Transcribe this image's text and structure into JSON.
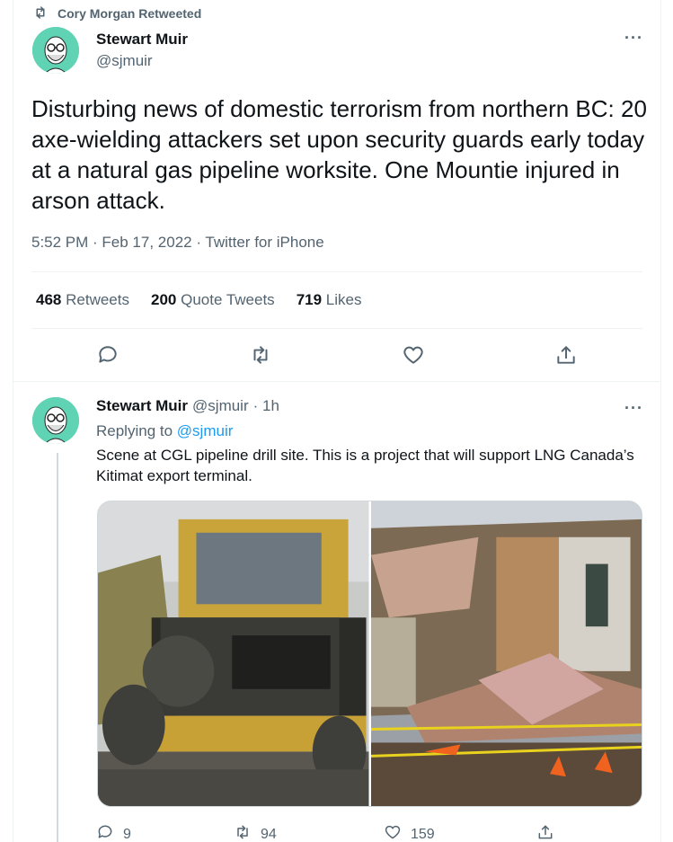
{
  "retweet_banner": {
    "text": "Cory Morgan Retweeted",
    "icon": "retweet-icon"
  },
  "main_tweet": {
    "author": {
      "name": "Stewart Muir",
      "handle": "@sjmuir"
    },
    "more_label": "···",
    "text": "Disturbing news of domestic terrorism from northern BC: 20 axe-wielding attackers set upon security guards early today at a natural gas pipeline worksite. One Mountie injured in arson attack.",
    "meta": "5:52 PM · Feb 17, 2022 · Twitter for iPhone",
    "stats": {
      "retweets_count": "468",
      "retweets_label": "Retweets",
      "quotes_count": "200",
      "quotes_label": "Quote Tweets",
      "likes_count": "719",
      "likes_label": "Likes"
    },
    "actions": [
      "reply-icon",
      "retweet-icon",
      "like-icon",
      "share-icon"
    ]
  },
  "reply_tweet": {
    "author": {
      "name": "Stewart Muir",
      "handle": "@sjmuir",
      "time": "· 1h"
    },
    "more_label": "···",
    "replying_prefix": "Replying to",
    "replying_to": "@sjmuir",
    "text": "Scene at CGL pipeline drill site. This is a project that will support LNG Canada’s Kitimat export terminal.",
    "media": [
      "damaged-truck-photo",
      "destroyed-building-photo"
    ],
    "counts": {
      "replies": "9",
      "retweets": "94",
      "likes": "159"
    }
  },
  "colors": {
    "accent": "#1d9bf0",
    "secondary_text": "#536471",
    "avatar_bg": "#5fd3b4"
  }
}
